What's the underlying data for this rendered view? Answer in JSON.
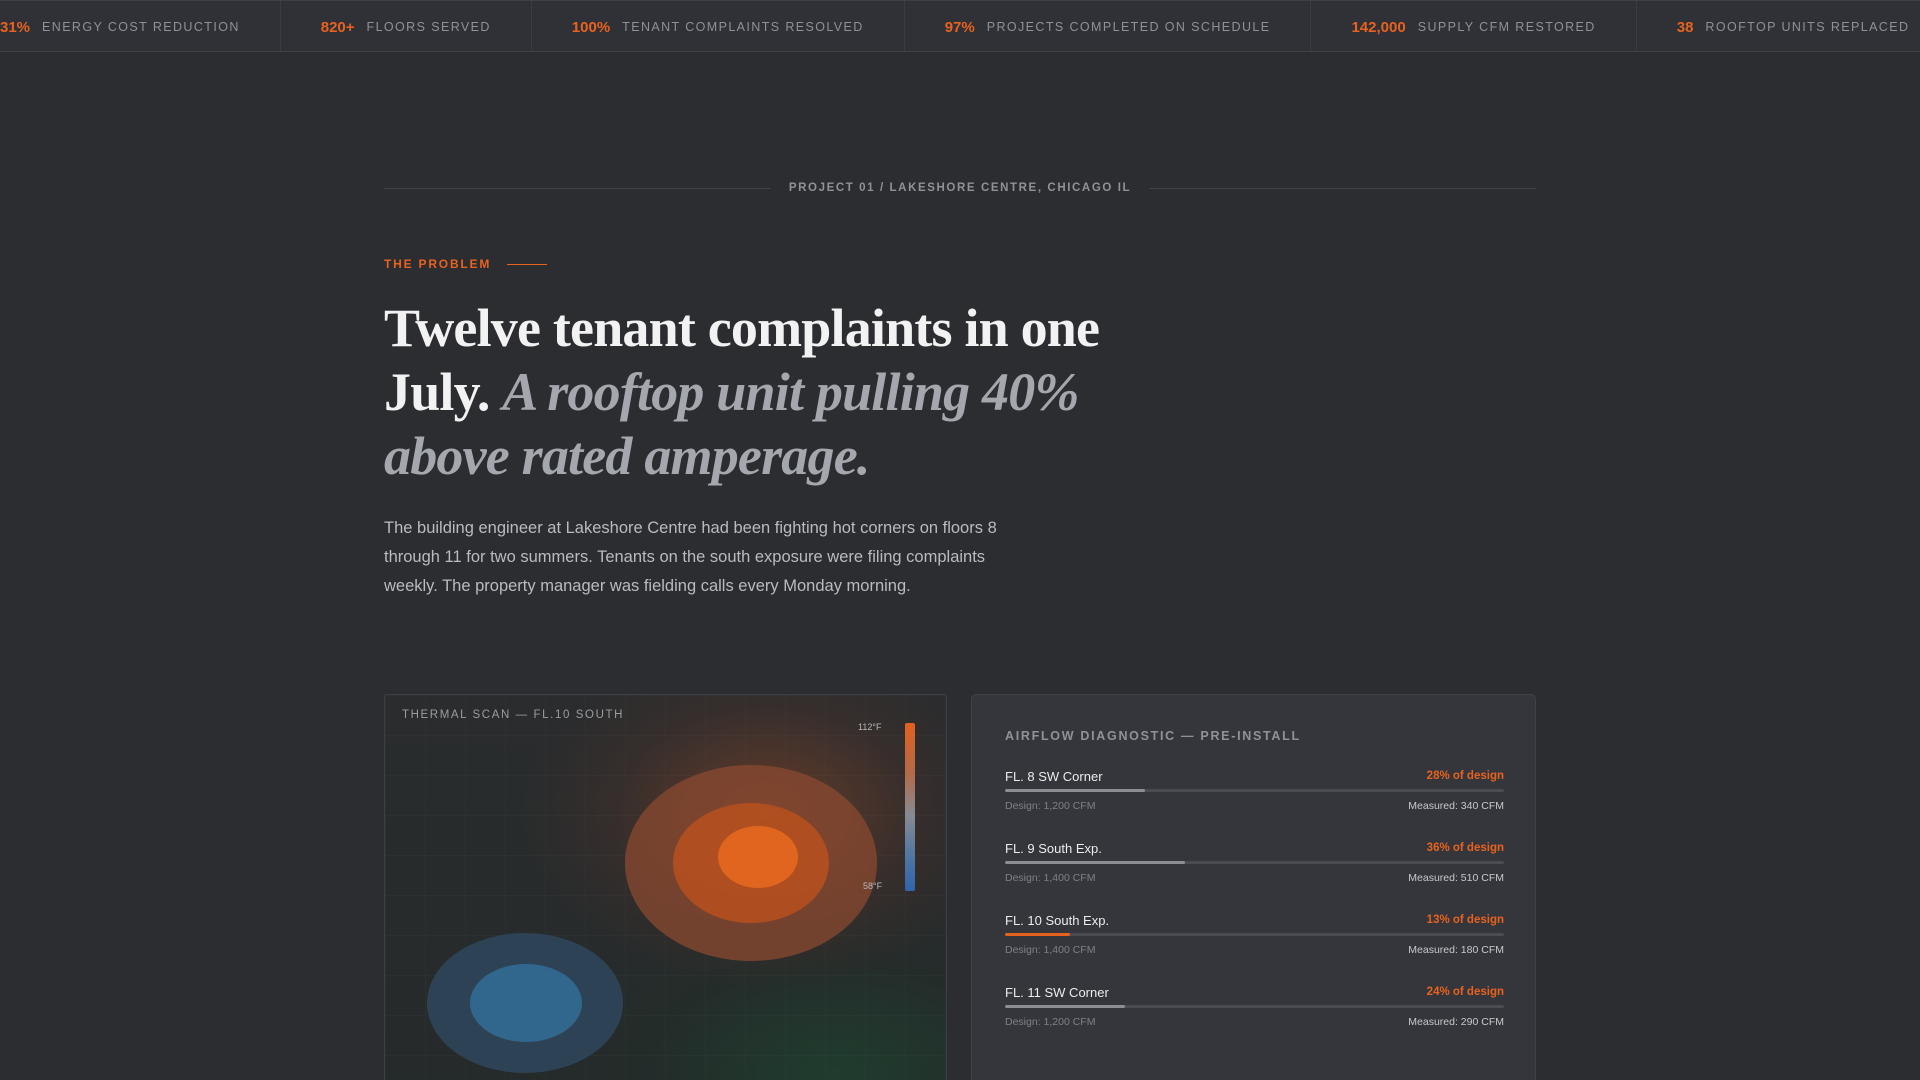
{
  "ticker": [
    {
      "value": "31%",
      "label": "ENERGY COST REDUCTION"
    },
    {
      "value": "820+",
      "label": "FLOORS SERVED"
    },
    {
      "value": "100%",
      "label": "TENANT COMPLAINTS RESOLVED"
    },
    {
      "value": "97%",
      "label": "PROJECTS COMPLETED ON SCHEDULE"
    },
    {
      "value": "142,000",
      "label": "SUPPLY CFM RESTORED"
    },
    {
      "value": "38",
      "label": "ROOFTOP UNITS REPLACED"
    }
  ],
  "section": {
    "project_label": "PROJECT 01 / LAKESHORE CENTRE, CHICAGO IL",
    "eyebrow": "THE PROBLEM",
    "headline_main": "Twelve tenant complaints in one July.",
    "headline_italic": "A rooftop unit pulling 40% above rated amperage.",
    "body": "The building engineer at Lakeshore Centre had been fighting hot corners on floors 8 through 11 for two summers. Tenants on the south exposure were filing complaints weekly. The property manager was fielding calls every Monday morning."
  },
  "thermal": {
    "title": "THERMAL SCAN — FL.10 SOUTH",
    "scale_high": "112°F",
    "scale_low": "58°F",
    "colors": {
      "hot": "#e0611f",
      "cool": "#2f64ad"
    }
  },
  "airflow": {
    "title": "AIRFLOW DIAGNOSTIC — PRE-INSTALL",
    "rows": [
      {
        "label": "FL. 8 SW Corner",
        "pct_label": "28% of design",
        "fraction": 0.28,
        "design": "Design: 1,200 CFM",
        "measured": "Measured: 340 CFM",
        "critical": false
      },
      {
        "label": "FL. 9 South Exp.",
        "pct_label": "36% of design",
        "fraction": 0.36,
        "design": "Design: 1,400 CFM",
        "measured": "Measured: 510 CFM",
        "critical": false
      },
      {
        "label": "FL. 10 South Exp.",
        "pct_label": "13% of design",
        "fraction": 0.13,
        "design": "Design: 1,400 CFM",
        "measured": "Measured: 180 CFM",
        "critical": true
      },
      {
        "label": "FL. 11 SW Corner",
        "pct_label": "24% of design",
        "fraction": 0.24,
        "design": "Design: 1,200 CFM",
        "measured": "Measured: 290 CFM",
        "critical": false
      }
    ]
  },
  "colors": {
    "accent": "#e8621f",
    "background": "#2b2d31",
    "panel": "#34363b"
  }
}
